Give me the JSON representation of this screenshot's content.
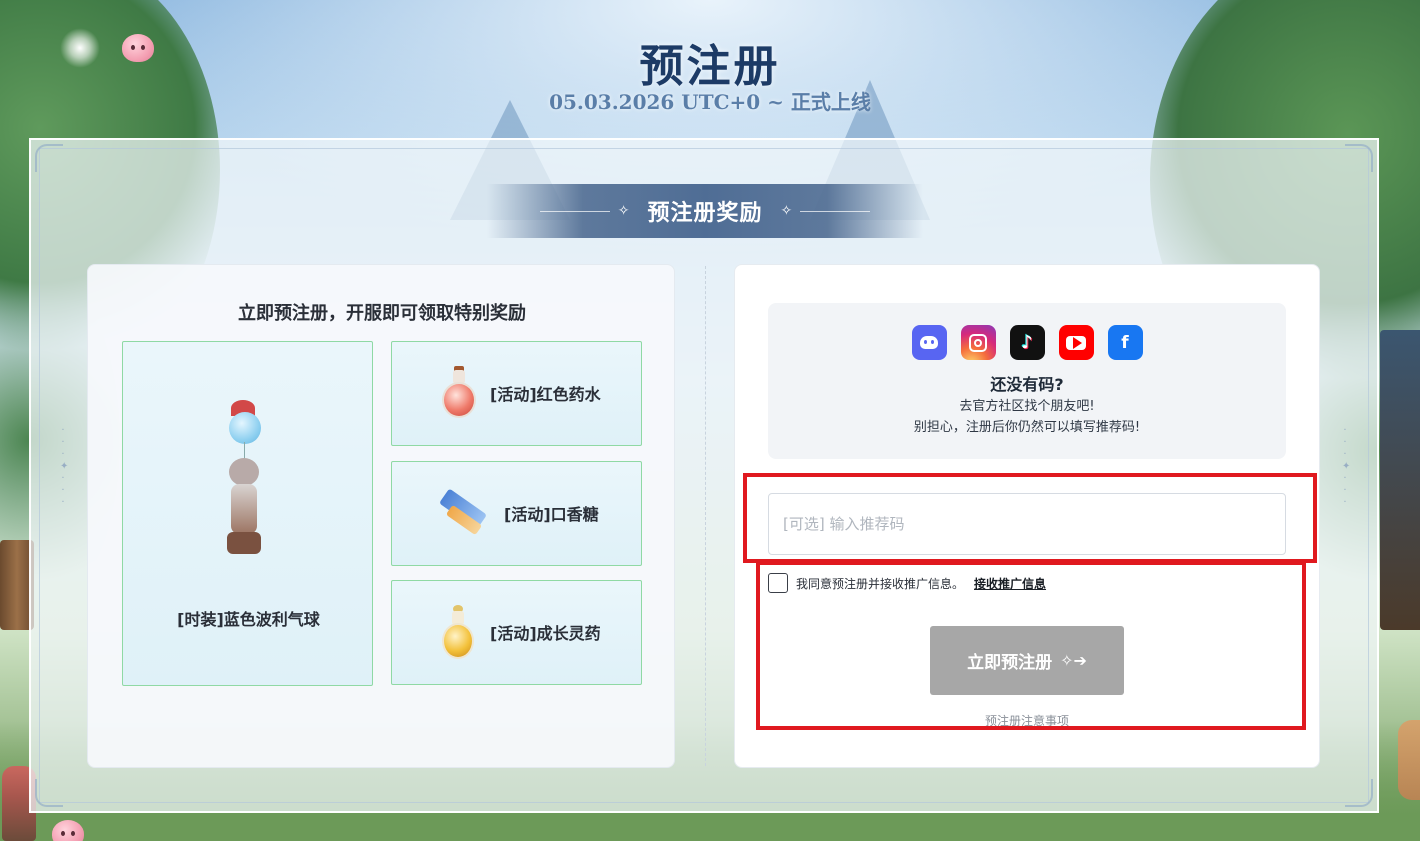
{
  "header": {
    "title": "预注册",
    "launch_date": "05.03.2026 UTC+0 ~ 正式上线"
  },
  "section": {
    "title": "预注册奖励"
  },
  "rewards": {
    "heading": "立即预注册，开服即可领取特别奖励",
    "main_item": {
      "label": "[时装]蓝色波利气球",
      "icon": "balloon-costume-icon"
    },
    "items": [
      {
        "label": "[活动]红色药水",
        "icon": "red-potion-icon"
      },
      {
        "label": "[活动]口香糖",
        "icon": "chewing-gum-icon"
      },
      {
        "label": "[活动]成长灵药",
        "icon": "growth-elixir-icon"
      }
    ]
  },
  "invite": {
    "socials": [
      {
        "name": "Discord",
        "icon": "discord-icon",
        "color": "#5865f2"
      },
      {
        "name": "Instagram",
        "icon": "instagram-icon",
        "color": "#d6297b"
      },
      {
        "name": "TikTok",
        "icon": "tiktok-icon",
        "color": "#111111"
      },
      {
        "name": "YouTube",
        "icon": "youtube-icon",
        "color": "#ff0000"
      },
      {
        "name": "Facebook",
        "icon": "facebook-icon",
        "color": "#1877f2"
      }
    ],
    "title": "还没有码?",
    "line1": "去官方社区找个朋友吧!",
    "line2": "别担心，注册后你仍然可以填写推荐码!"
  },
  "form": {
    "referral_placeholder": "[可选] 输入推荐码",
    "referral_value": "",
    "agree_text": "我同意预注册并接收推广信息。",
    "agree_link": "接收推广信息",
    "agree_checked": false,
    "submit_label": "立即预注册",
    "notice_link": "预注册注意事项"
  },
  "colors": {
    "title": "#1d3b66",
    "ribbon": "#4f6d95",
    "reward_border": "#8fd9a4",
    "submit_disabled": "#a7a7a7",
    "highlight": "#e0191f"
  }
}
